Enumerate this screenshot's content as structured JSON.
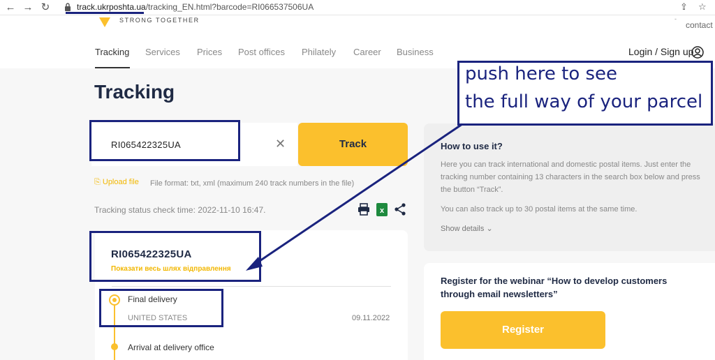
{
  "browser": {
    "url_host": "track.ukrposhta.ua",
    "url_path": "/tracking_EN.html?barcode=RI066537506UA"
  },
  "header": {
    "slogan": "STRONG TOGETHER",
    "contact": "contact c",
    "nav": [
      "Tracking",
      "Services",
      "Prices",
      "Post offices",
      "Philately",
      "Career",
      "Business"
    ],
    "login": "Login / Sign up"
  },
  "main": {
    "title": "Tracking",
    "search_value": "RI065422325UA",
    "track_label": "Track",
    "upload_label": "Upload file",
    "file_format": "File format: txt, xml (maximum 240 track numbers in the file)",
    "check_time": "Tracking status check time: 2022-11-10 16:47."
  },
  "result": {
    "barcode": "RI065422325UA",
    "full_route_link": "Показати весь шлях відправлення",
    "events": [
      {
        "title": "Final delivery",
        "place": "UNITED STATES",
        "date": "09.11.2022"
      },
      {
        "title": "Arrival at delivery office"
      }
    ]
  },
  "how_to": {
    "title": "How to use it?",
    "lines": [
      "Here you can track international and domestic postal items. Just enter the",
      "tracking number containing 13 characters in the search box below and press",
      "the button “Track”.",
      "You can also track up to 30 postal items at the same time."
    ],
    "show_details": "Show details"
  },
  "webinar": {
    "title_line1": "Register for the webinar “How to develop customers",
    "title_line2": "through email newsletters”",
    "register_label": "Register"
  },
  "annotation": {
    "line1": "push here to see",
    "line2": "the full way of your parcel",
    "color": "#1a237e"
  },
  "colors": {
    "accent": "#fbc02d",
    "heading": "#1f2a44"
  }
}
